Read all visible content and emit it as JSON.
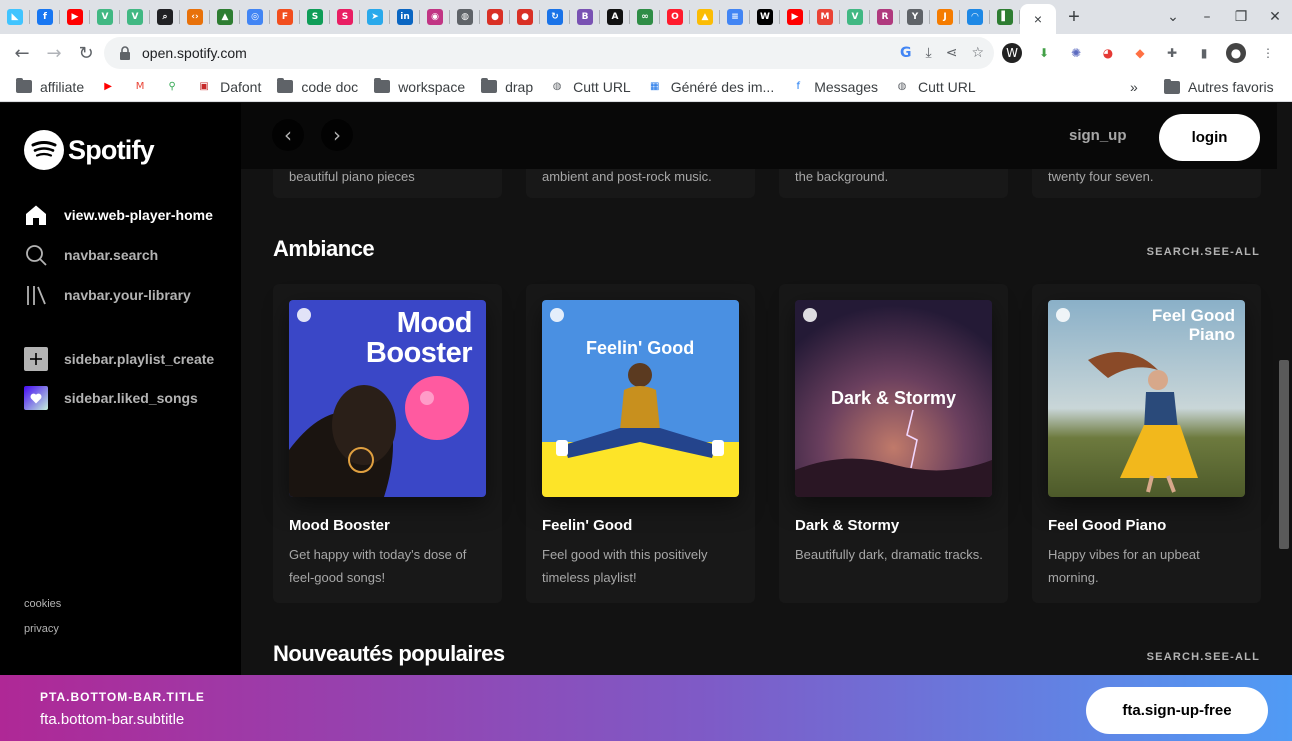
{
  "browser": {
    "tab_favicons": [
      {
        "name": "flutter",
        "color": "#40c4ff",
        "glyph": "◣"
      },
      {
        "name": "facebook",
        "color": "#1877f2",
        "glyph": "f"
      },
      {
        "name": "youtube",
        "color": "#ff0000",
        "glyph": "▶"
      },
      {
        "name": "vue",
        "color": "#41b883",
        "glyph": "V"
      },
      {
        "name": "vue",
        "color": "#41b883",
        "glyph": "V"
      },
      {
        "name": "search",
        "color": "#202124",
        "glyph": "⌕"
      },
      {
        "name": "code",
        "color": "#e8710a",
        "glyph": "‹›"
      },
      {
        "name": "mountain",
        "color": "#2e7d32",
        "glyph": "▲"
      },
      {
        "name": "api",
        "color": "#4285f4",
        "glyph": "◎"
      },
      {
        "name": "figma",
        "color": "#f24e1e",
        "glyph": "F"
      },
      {
        "name": "s1",
        "color": "#0f9d58",
        "glyph": "S"
      },
      {
        "name": "shield",
        "color": "#e91e63",
        "glyph": "S"
      },
      {
        "name": "telegram",
        "color": "#29a9eb",
        "glyph": "➤"
      },
      {
        "name": "linkedin",
        "color": "#0a66c2",
        "glyph": "in"
      },
      {
        "name": "instagram",
        "color": "#c13584",
        "glyph": "◉"
      },
      {
        "name": "globe",
        "color": "#5f6368",
        "glyph": "◍"
      },
      {
        "name": "record",
        "color": "#d93025",
        "glyph": "●"
      },
      {
        "name": "record",
        "color": "#d93025",
        "glyph": "●"
      },
      {
        "name": "sync",
        "color": "#1a73e8",
        "glyph": "↻"
      },
      {
        "name": "bootstrap",
        "color": "#7952b3",
        "glyph": "B"
      },
      {
        "name": "ai",
        "color": "#111111",
        "glyph": "A"
      },
      {
        "name": "gfg",
        "color": "#2f8d46",
        "glyph": "∞"
      },
      {
        "name": "opera",
        "color": "#ff1b2d",
        "glyph": "O"
      },
      {
        "name": "drive",
        "color": "#fbbc04",
        "glyph": "▲"
      },
      {
        "name": "docs",
        "color": "#4285f4",
        "glyph": "≡"
      },
      {
        "name": "wix",
        "color": "#000000",
        "glyph": "W"
      },
      {
        "name": "youtube",
        "color": "#ff0000",
        "glyph": "▶"
      },
      {
        "name": "gmail",
        "color": "#ea4335",
        "glyph": "M"
      },
      {
        "name": "vue",
        "color": "#41b883",
        "glyph": "V"
      },
      {
        "name": "brand",
        "color": "#b03a7e",
        "glyph": "R"
      },
      {
        "name": "script",
        "color": "#5f6368",
        "glyph": "Y"
      },
      {
        "name": "pdf",
        "color": "#f57c00",
        "glyph": "J"
      },
      {
        "name": "rainbow",
        "color": "#1e88e5",
        "glyph": "◠"
      },
      {
        "name": "flag",
        "color": "#2e7d32",
        "glyph": "▌"
      }
    ],
    "active_tab_close": "×",
    "new_tab": "+",
    "window_controls": [
      "⌄",
      "–",
      "❐",
      "✕"
    ],
    "url": "open.spotify.com",
    "bookmarks": [
      {
        "label": "affiliate",
        "type": "folder"
      },
      {
        "label": "",
        "type": "youtube"
      },
      {
        "label": "",
        "type": "gmail"
      },
      {
        "label": "",
        "type": "maps"
      },
      {
        "label": "Dafont",
        "type": "dafont"
      },
      {
        "label": "code doc",
        "type": "folder"
      },
      {
        "label": "workspace",
        "type": "folder"
      },
      {
        "label": "drap",
        "type": "folder"
      },
      {
        "label": "Cutt URL",
        "type": "globe"
      },
      {
        "label": "Généré des im...",
        "type": "grid"
      },
      {
        "label": "Messages",
        "type": "facebook"
      },
      {
        "label": "Cutt URL",
        "type": "globe"
      }
    ],
    "bookmarks_more": "»",
    "other_bookmarks": "Autres favoris"
  },
  "sidebar": {
    "logo_text": "Spotify",
    "nav": [
      {
        "label": "view.web-player-home",
        "icon": "home-icon",
        "active": true
      },
      {
        "label": "navbar.search",
        "icon": "search-icon",
        "active": false
      },
      {
        "label": "navbar.your-library",
        "icon": "library-icon",
        "active": false
      }
    ],
    "create_playlist": "sidebar.playlist_create",
    "liked_songs": "sidebar.liked_songs",
    "links": [
      "cookies",
      "privacy"
    ]
  },
  "topbar": {
    "signup": "sign_up",
    "login": "login"
  },
  "previous_row": [
    "beautiful piano pieces",
    "ambient and post-rock music.",
    "the background.",
    "twenty four seven."
  ],
  "sections": [
    {
      "title": "Ambiance",
      "see_all": "SEARCH.SEE-ALL"
    },
    {
      "title": "Nouveautés populaires",
      "see_all": "SEARCH.SEE-ALL"
    }
  ],
  "cards": [
    {
      "title": "Mood Booster",
      "desc": "Get happy with today's dose of feel-good songs!",
      "cover_text": "Mood Booster",
      "cover_bg": "#3a47c7"
    },
    {
      "title": "Feelin' Good",
      "desc": "Feel good with this positively timeless playlist!",
      "cover_text": "Feelin' Good",
      "cover_bg": "#4a90e2"
    },
    {
      "title": "Dark & Stormy",
      "desc": "Beautifully dark, dramatic tracks.",
      "cover_text": "Dark & Stormy",
      "cover_bg": "#3b2a4a"
    },
    {
      "title": "Feel Good Piano",
      "desc": "Happy vibes for an upbeat morning.",
      "cover_text": "Feel Good Piano",
      "cover_bg": "#8ab0c8"
    }
  ],
  "bottom_bar": {
    "title": "PTA.BOTTOM-BAR.TITLE",
    "subtitle": "fta.bottom-bar.subtitle",
    "cta": "fta.sign-up-free"
  },
  "colors": {
    "accent_green": "#1db954",
    "gradient_start": "#af2896",
    "gradient_end": "#509bf5"
  }
}
